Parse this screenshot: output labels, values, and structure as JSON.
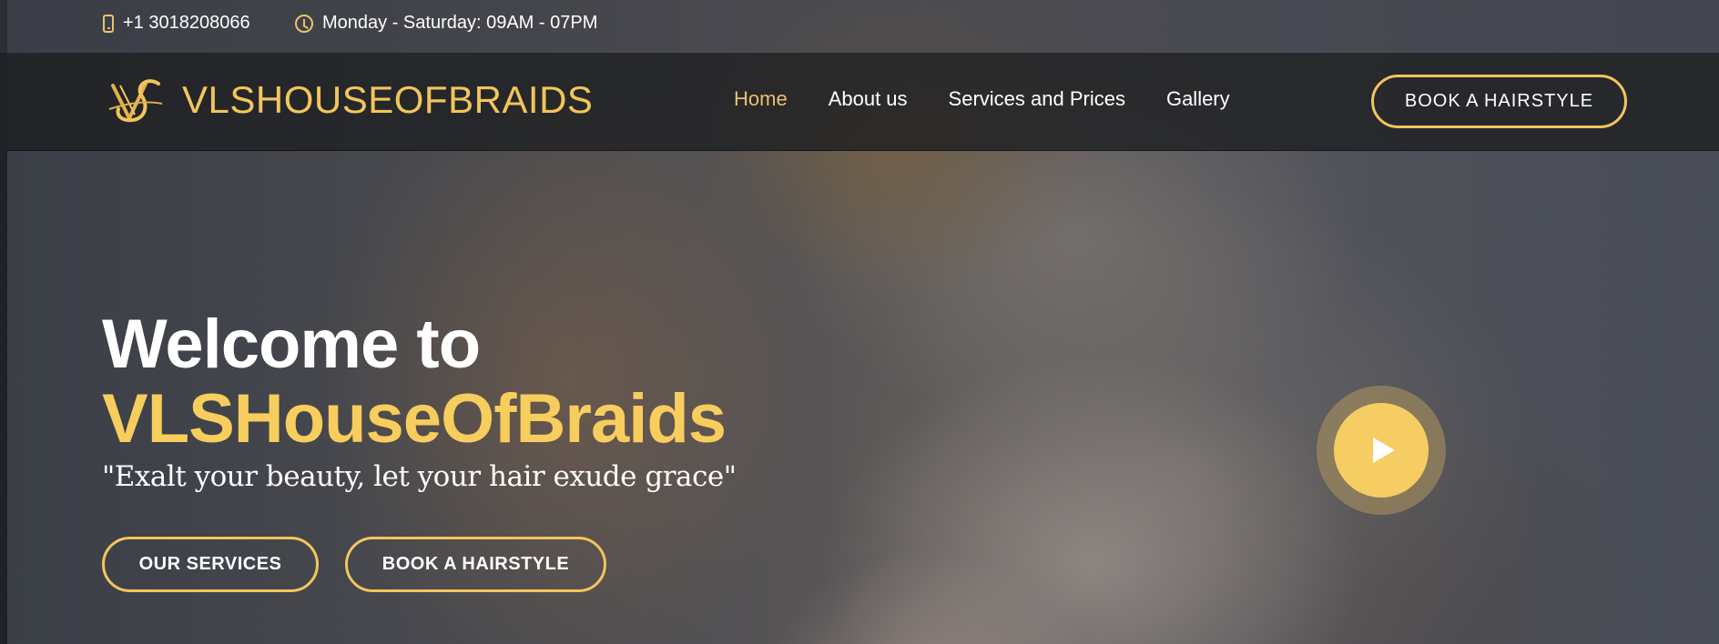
{
  "topbar": {
    "phone": "+1 3018208066",
    "hours": "Monday - Saturday: 09AM - 07PM",
    "phone_icon": "phone-icon",
    "hours_icon": "clock-icon"
  },
  "header": {
    "logo_text": "VLSHOUSEOFBRAIDS",
    "nav": [
      {
        "label": "Home",
        "active": true
      },
      {
        "label": "About us",
        "active": false
      },
      {
        "label": "Services and Prices",
        "active": false
      },
      {
        "label": "Gallery",
        "active": false
      }
    ],
    "cta_label": "BOOK A HAIRSTYLE"
  },
  "hero": {
    "title_line1": "Welcome to",
    "title_line2": "VLSHouseOfBraids",
    "tagline": "\"Exalt your beauty, let your hair exude grace\"",
    "btn_services": "OUR SERVICES",
    "btn_book": "BOOK A HAIRSTYLE",
    "play_icon": "play-icon"
  },
  "colors": {
    "accent": "#f2c55c",
    "nav_active": "#e6c074",
    "navbar_bg": "#1e2022"
  }
}
